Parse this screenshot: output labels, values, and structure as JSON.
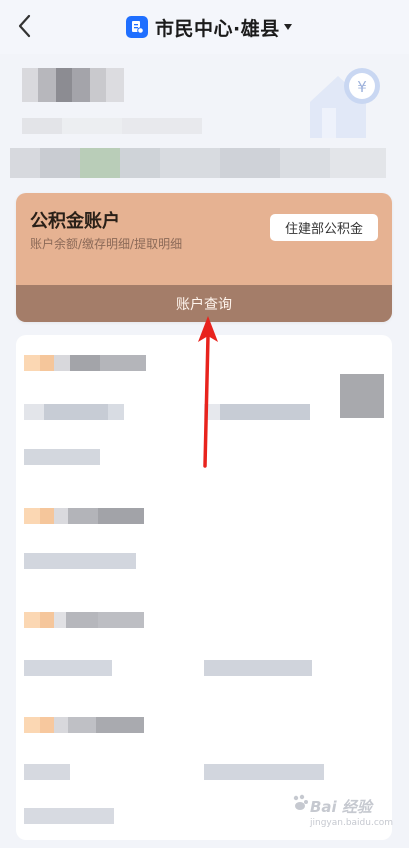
{
  "header": {
    "title": "市民中心·雄县",
    "back_icon": "chevron-left-icon",
    "app_icon": "document-icon",
    "dropdown_icon": "caret-down-icon"
  },
  "card": {
    "title": "公积金账户",
    "subtitle": "账户余额/缴存明细/提取明细",
    "button_label": "住建部公积金",
    "bottom_label": "账户查询"
  },
  "watermark": {
    "text": "Bai 经验",
    "sub": "jingyan.baidu.com"
  },
  "colors": {
    "card_bg": "#e6b292",
    "card_bottom": "#a47d69",
    "accent_blue": "#1f6fff",
    "arrow_red": "#e8231d"
  }
}
